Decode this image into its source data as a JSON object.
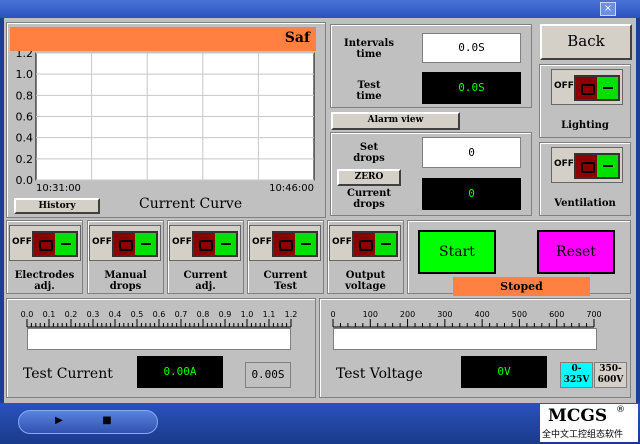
{
  "window": {
    "close_glyph": "×"
  },
  "chart": {
    "header_text": "Saf",
    "label": "Current Curve",
    "history_button": "History"
  },
  "chart_data": {
    "type": "line",
    "title": "",
    "xlabel": "",
    "ylabel": "",
    "x_ticks": [
      "10:31:00",
      "10:46:00"
    ],
    "y_ticks": [
      "0.0",
      "0.2",
      "0.4",
      "0.6",
      "0.8",
      "1.0",
      "1.2"
    ],
    "ylim": [
      0,
      1.2
    ],
    "grid": true,
    "series": []
  },
  "timing": {
    "intervals_label": "Intervals\ntime",
    "intervals_value": "0.0S",
    "test_time_label": "Test\ntime",
    "test_time_value": "0.0S"
  },
  "alarm_button": "Alarm view",
  "drops": {
    "set_label": "Set\ndrops",
    "set_value": "0",
    "zero_button": "ZERO",
    "current_label": "Current\ndrops",
    "current_value": "0"
  },
  "back_button": "Back",
  "toggles": {
    "off_text": "OFF",
    "lighting_label": "Lighting",
    "ventilation_label": "Ventilation",
    "electrodes_label": "Electrodes\nadj.",
    "manual_label": "Manual\ndrops",
    "current_adj_label": "Current\nadj.",
    "current_test_label": "Current\nTest",
    "output_label": "Output\nvoltage"
  },
  "controls": {
    "start_button": "Start",
    "reset_button": "Reset",
    "status_text": "Stoped",
    "start_color": "#00ff00",
    "reset_color": "#ff00ff",
    "status_color": "#ff8040"
  },
  "current_meter": {
    "scale": [
      "0.0",
      "0.1",
      "0.2",
      "0.3",
      "0.4",
      "0.5",
      "0.6",
      "0.7",
      "0.8",
      "0.9",
      "1.0",
      "1.1",
      "1.2"
    ],
    "label": "Test Current",
    "value": "0.00A",
    "time_value": "0.00S",
    "level": 0
  },
  "voltage_meter": {
    "scale": [
      "0",
      "100",
      "200",
      "300",
      "400",
      "500",
      "600",
      "700"
    ],
    "label": "Test Voltage",
    "value": "0V",
    "range_low": "0-\n325V",
    "range_high": "350-\n600V"
  },
  "footer": {
    "logo": "MCGS",
    "logo_mark": "®",
    "subtitle": "全中文工控组态软件",
    "play_glyph": "▶",
    "stop_glyph": "■"
  }
}
